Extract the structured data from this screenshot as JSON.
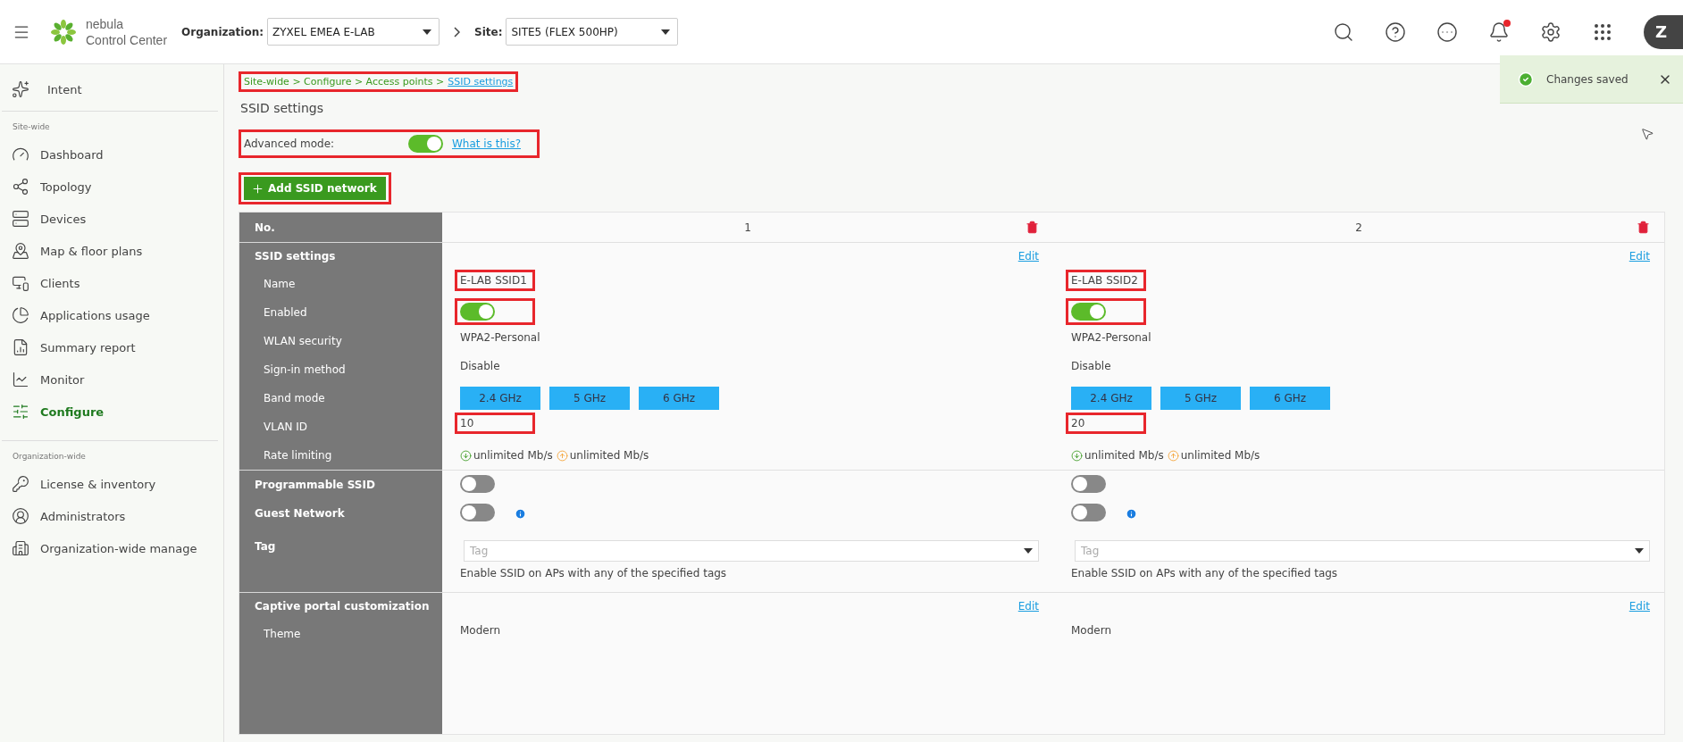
{
  "topbar": {
    "logo_line1": "nebula",
    "logo_line2": "Control Center",
    "org_label": "Organization:",
    "org_value": "ZYXEL EMEA E-LAB",
    "site_label": "Site:",
    "site_value": "SITE5 (FLEX 500HP)",
    "notification_dot": true,
    "avatar": "Z"
  },
  "sidebar": {
    "top_item": {
      "label": "Intent"
    },
    "sections": [
      {
        "title": "Site-wide",
        "items": [
          {
            "label": "Dashboard",
            "selected": false
          },
          {
            "label": "Topology",
            "selected": false
          },
          {
            "label": "Devices",
            "selected": false
          },
          {
            "label": "Map & floor plans",
            "selected": false
          },
          {
            "label": "Clients",
            "selected": false
          },
          {
            "label": "Applications usage",
            "selected": false
          },
          {
            "label": "Summary report",
            "selected": false
          },
          {
            "label": "Monitor",
            "selected": false
          },
          {
            "label": "Configure",
            "selected": true
          }
        ]
      },
      {
        "title": "Organization-wide",
        "items": [
          {
            "label": "License & inventory",
            "selected": false
          },
          {
            "label": "Administrators",
            "selected": false
          },
          {
            "label": "Organization-wide manage",
            "selected": false
          }
        ]
      }
    ]
  },
  "toast": {
    "message": "Changes saved"
  },
  "breadcrumb": {
    "trail": "Site-wide > Configure > Access points >",
    "current": "SSID settings",
    "highlighted": true
  },
  "page_title": "SSID settings",
  "advanced_mode": {
    "label": "Advanced mode:",
    "on": true,
    "help_link": "What is this?",
    "highlighted": true
  },
  "add_button": {
    "label": "Add SSID network",
    "highlighted": true
  },
  "table": {
    "groups": [
      {
        "rows": [
          {
            "kind": "number",
            "label": "No.",
            "cells": [
              {
                "text": "1"
              },
              {
                "text": "2"
              }
            ]
          }
        ]
      },
      {
        "rows": [
          {
            "kind": "section",
            "label": "SSID settings",
            "cells": [
              {
                "link": "Edit"
              },
              {
                "link": "Edit"
              }
            ]
          },
          {
            "kind": "text",
            "label": "Name",
            "cells": [
              {
                "text": "E-LAB SSID1",
                "highlighted": true
              },
              {
                "text": "E-LAB SSID2",
                "highlighted": true
              }
            ]
          },
          {
            "kind": "toggle",
            "label": "Enabled",
            "cells": [
              {
                "on": true,
                "highlighted": true
              },
              {
                "on": true,
                "highlighted": true
              }
            ]
          },
          {
            "kind": "text",
            "label": "WLAN security",
            "cells": [
              {
                "text": "WPA2-Personal",
                "highlighted": false
              },
              {
                "text": "WPA2-Personal",
                "highlighted": false
              }
            ]
          },
          {
            "kind": "text",
            "label": "Sign-in method",
            "cells": [
              {
                "text": "Disable",
                "highlighted": false
              },
              {
                "text": "Disable",
                "highlighted": false
              }
            ]
          },
          {
            "kind": "bands",
            "label": "Band mode",
            "cells": [
              {
                "bands": [
                  "2.4 GHz",
                  "5 GHz",
                  "6 GHz"
                ]
              },
              {
                "bands": [
                  "2.4 GHz",
                  "5 GHz",
                  "6 GHz"
                ]
              }
            ]
          },
          {
            "kind": "text",
            "label": "VLAN ID",
            "cells": [
              {
                "text": "10",
                "highlighted": true
              },
              {
                "text": "20",
                "highlighted": true
              }
            ]
          },
          {
            "kind": "rate",
            "label": "Rate limiting",
            "cells": [
              {
                "down": "unlimited Mb/s",
                "up": "unlimited Mb/s"
              },
              {
                "down": "unlimited Mb/s",
                "up": "unlimited Mb/s"
              }
            ]
          }
        ]
      },
      {
        "rows": [
          {
            "kind": "toggle",
            "label": "Programmable SSID",
            "bold": true,
            "cells": [
              {
                "on": false,
                "highlighted": false
              },
              {
                "on": false,
                "highlighted": false
              }
            ]
          },
          {
            "kind": "toggle",
            "label": "Guest Network",
            "bold": true,
            "cells": [
              {
                "on": false,
                "highlighted": false,
                "info": true
              },
              {
                "on": false,
                "highlighted": false,
                "info": true
              }
            ]
          },
          {
            "kind": "tag",
            "label": "Tag",
            "bold": true,
            "cells": [
              {
                "placeholder": "Tag",
                "hint": "Enable SSID on APs with any of the specified tags"
              },
              {
                "placeholder": "Tag",
                "hint": "Enable SSID on APs with any of the specified tags"
              }
            ]
          }
        ]
      },
      {
        "rows": [
          {
            "kind": "section",
            "label": "Captive portal customization",
            "cells": [
              {
                "link": "Edit"
              },
              {
                "link": "Edit"
              }
            ]
          },
          {
            "kind": "text",
            "label": "Theme",
            "cells": [
              {
                "text": "Modern",
                "highlighted": false
              },
              {
                "text": "Modern",
                "highlighted": false
              }
            ]
          }
        ]
      }
    ]
  }
}
